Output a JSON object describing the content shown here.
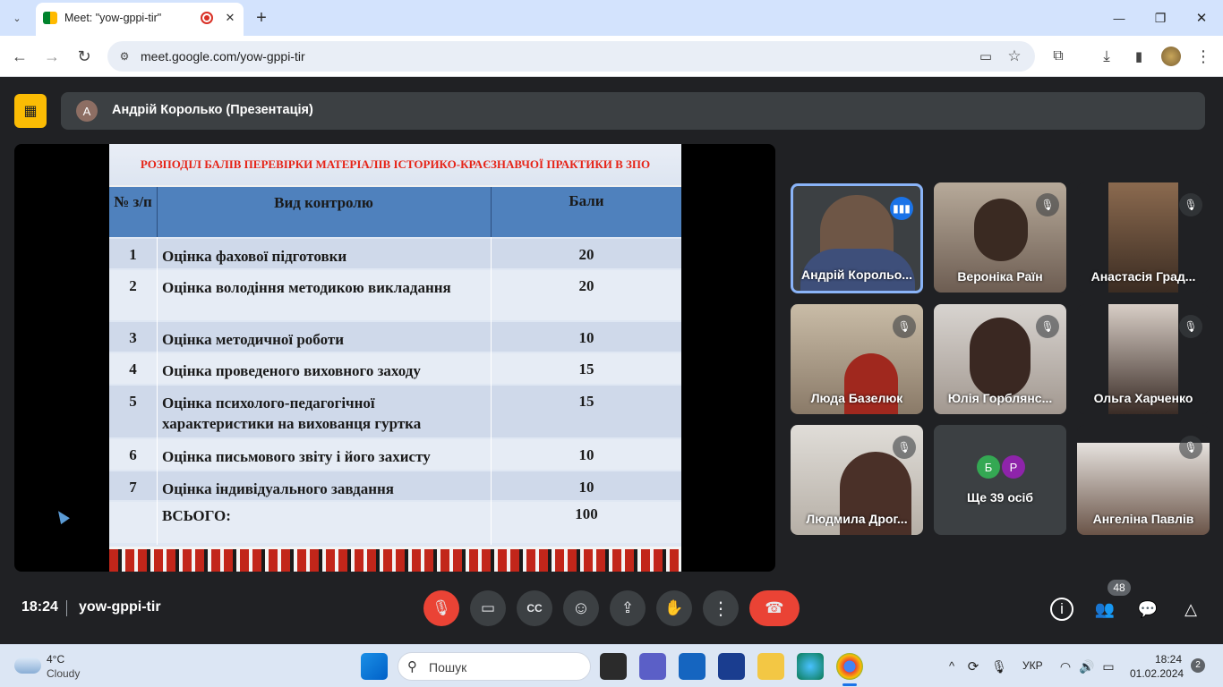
{
  "browser": {
    "tab_title": "Meet: \"yow-gppi-tir\"",
    "url": "meet.google.com/yow-gppi-tir",
    "new_tab_symbol": "+",
    "window_controls": {
      "minimize": "—",
      "maximize": "❐",
      "close": "✕"
    }
  },
  "meet": {
    "presenter_initial": "А",
    "presenter_label": "Андрій Королько (Презентація)",
    "slide": {
      "title": "РОЗПОДІЛ БАЛІВ ПЕРЕВІРКИ МАТЕРІАЛІВ ІСТОРИКО-КРАЄЗНАВЧОЇ ПРАКТИКИ В ЗПО",
      "header": {
        "num": "№ з/п",
        "kind": "Вид контролю",
        "points": "Бали"
      },
      "rows": [
        {
          "num": "1",
          "kind": "Оцінка фахової підготовки",
          "points": "20"
        },
        {
          "num": "2",
          "kind": "Оцінка володіння методикою викладання",
          "points": "20"
        },
        {
          "num": "3",
          "kind": "Оцінка методичної роботи",
          "points": "10"
        },
        {
          "num": "4",
          "kind": "Оцінка проведеного виховного заходу",
          "points": "15"
        },
        {
          "num": "5",
          "kind": "Оцінка психолого-педагогічної характеристики на вихованця гуртка",
          "points": "15"
        },
        {
          "num": "6",
          "kind": "Оцінка письмового звіту і його захисту",
          "points": "10"
        },
        {
          "num": "7",
          "kind": "Оцінка індивідуального завдання",
          "points": "10"
        }
      ],
      "total_label": "ВСЬОГО:",
      "total_points": "100"
    },
    "participants": [
      {
        "name": "Андрій Корольо...",
        "color": "#4d5a7a",
        "speaking": true
      },
      {
        "name": "Вероніка Раїн",
        "color": "#8a7766"
      },
      {
        "name": "Анастасія Град...",
        "color": "#6f5238"
      },
      {
        "name": "Люда Базелюк",
        "color": "#a89a84"
      },
      {
        "name": "Юлія Горблянс...",
        "color": "#9a8e86"
      },
      {
        "name": "Ольга Харченко",
        "color": "#5a4a40"
      },
      {
        "name": "Людмила Дрог...",
        "color": "#c6c0b8"
      },
      {
        "name": "Ще 39 осіб",
        "color": "#3c4043",
        "avatars": [
          "Б",
          "Р"
        ]
      },
      {
        "name": "Ангеліна Павлів",
        "color": "#b8a898"
      }
    ],
    "time": "18:24",
    "meeting_code": "yow-gppi-tir",
    "participant_count": "48"
  },
  "taskbar": {
    "weather_temp": "4°C",
    "weather_desc": "Cloudy",
    "search_placeholder": "Пошук",
    "lang": "УКР",
    "clock_time": "18:24",
    "clock_date": "01.02.2024",
    "notif_count": "2"
  }
}
